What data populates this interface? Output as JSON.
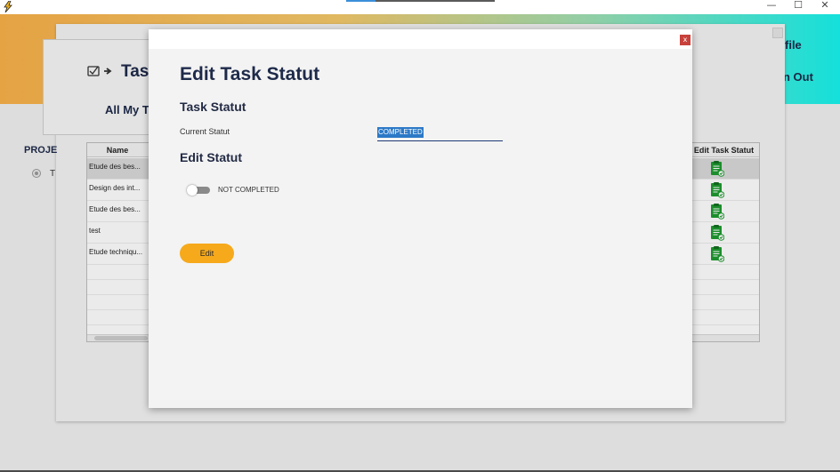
{
  "window": {
    "minimize_glyph": "—",
    "maximize_glyph": "☐",
    "close_glyph": "✕"
  },
  "header": {
    "profile_text": "file",
    "signout_text": "n Out"
  },
  "main": {
    "page_title": "Task",
    "subtitle": "All My T",
    "projects_label": "PROJE",
    "radio_label": "T",
    "table": {
      "columns": [
        "Name",
        "Edit Task Statut"
      ],
      "rows": [
        {
          "name": "Etude des bes...",
          "icon": "clipboard-icon"
        },
        {
          "name": "Design des int...",
          "icon": "clipboard-icon"
        },
        {
          "name": "Etude des bes...",
          "icon": "clipboard-icon"
        },
        {
          "name": "test",
          "icon": "clipboard-icon"
        },
        {
          "name": "Etude techniqu...",
          "icon": "clipboard-icon"
        }
      ],
      "selected_row": 0
    }
  },
  "dialog": {
    "close_label": "x",
    "title": "Edit Task Statut",
    "section_task_statut": "Task Statut",
    "current_statut_label": "Current Statut",
    "current_statut_value": "COMPLETED",
    "section_edit_statut": "Edit Statut",
    "toggle_label": "NOT COMPLETED",
    "toggle_on": false,
    "edit_button_label": "Edit"
  },
  "colors": {
    "accent_orange": "#f6a91b",
    "header_gradient_start": "#f9b14a",
    "header_gradient_end": "#17f3ee",
    "title_navy": "#1e2a4a",
    "close_red": "#c8413b",
    "icon_green": "#1e9b2f"
  }
}
